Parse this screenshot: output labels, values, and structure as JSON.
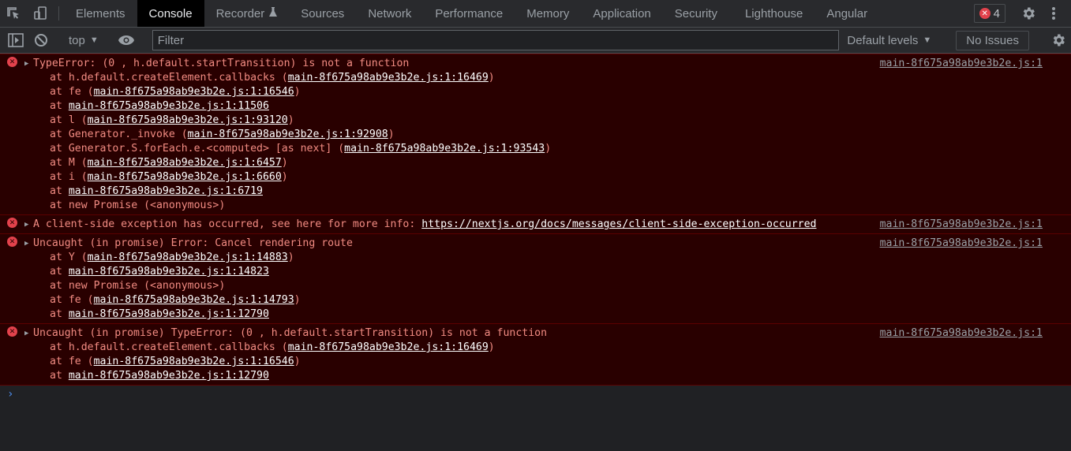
{
  "tabbar": {
    "tabs": [
      {
        "label": "Elements",
        "active": false
      },
      {
        "label": "Console",
        "active": true
      },
      {
        "label": "Recorder",
        "active": false
      },
      {
        "label": "Sources",
        "active": false
      },
      {
        "label": "Network",
        "active": false
      },
      {
        "label": "Performance",
        "active": false
      },
      {
        "label": "Memory",
        "active": false
      },
      {
        "label": "Application",
        "active": false
      },
      {
        "label": "Security",
        "active": false
      },
      {
        "label": "Lighthouse",
        "active": false
      },
      {
        "label": "Angular",
        "active": false
      }
    ],
    "error_count": "4"
  },
  "toolbar": {
    "context": "top",
    "filter_placeholder": "Filter",
    "filter_value": "",
    "levels": "Default levels",
    "issues": "No Issues"
  },
  "messages": [
    {
      "text": "TypeError: (0 , h.default.startTransition) is not a function",
      "source": "main-8f675a98ab9e3b2e.js:1",
      "frames": [
        {
          "prefix": "at h.default.createElement.callbacks (",
          "link": "main-8f675a98ab9e3b2e.js:1:16469",
          "suffix": ")"
        },
        {
          "prefix": "at fe (",
          "link": "main-8f675a98ab9e3b2e.js:1:16546",
          "suffix": ")"
        },
        {
          "prefix": "at ",
          "link": "main-8f675a98ab9e3b2e.js:1:11506",
          "suffix": ""
        },
        {
          "prefix": "at l (",
          "link": "main-8f675a98ab9e3b2e.js:1:93120",
          "suffix": ")"
        },
        {
          "prefix": "at Generator._invoke (",
          "link": "main-8f675a98ab9e3b2e.js:1:92908",
          "suffix": ")"
        },
        {
          "prefix": "at Generator.S.forEach.e.<computed> [as next] (",
          "link": "main-8f675a98ab9e3b2e.js:1:93543",
          "suffix": ")"
        },
        {
          "prefix": "at M (",
          "link": "main-8f675a98ab9e3b2e.js:1:6457",
          "suffix": ")"
        },
        {
          "prefix": "at i (",
          "link": "main-8f675a98ab9e3b2e.js:1:6660",
          "suffix": ")"
        },
        {
          "prefix": "at ",
          "link": "main-8f675a98ab9e3b2e.js:1:6719",
          "suffix": ""
        },
        {
          "prefix": "at new Promise (<anonymous>)",
          "link": "",
          "suffix": ""
        }
      ]
    },
    {
      "text": "A client-side exception has occurred, see here for more info: ",
      "text_link": "https://nextjs.org/docs/messages/client-side-exception-occurred",
      "source": "main-8f675a98ab9e3b2e.js:1",
      "frames": []
    },
    {
      "text": "Uncaught (in promise) Error: Cancel rendering route",
      "source": "main-8f675a98ab9e3b2e.js:1",
      "frames": [
        {
          "prefix": "at Y (",
          "link": "main-8f675a98ab9e3b2e.js:1:14883",
          "suffix": ")"
        },
        {
          "prefix": "at ",
          "link": "main-8f675a98ab9e3b2e.js:1:14823",
          "suffix": ""
        },
        {
          "prefix": "at new Promise (<anonymous>)",
          "link": "",
          "suffix": ""
        },
        {
          "prefix": "at fe (",
          "link": "main-8f675a98ab9e3b2e.js:1:14793",
          "suffix": ")"
        },
        {
          "prefix": "at ",
          "link": "main-8f675a98ab9e3b2e.js:1:12790",
          "suffix": ""
        }
      ]
    },
    {
      "text": "Uncaught (in promise) TypeError: (0 , h.default.startTransition) is not a function",
      "source": "main-8f675a98ab9e3b2e.js:1",
      "frames": [
        {
          "prefix": "at h.default.createElement.callbacks (",
          "link": "main-8f675a98ab9e3b2e.js:1:16469",
          "suffix": ")"
        },
        {
          "prefix": "at fe (",
          "link": "main-8f675a98ab9e3b2e.js:1:16546",
          "suffix": ")"
        },
        {
          "prefix": "at ",
          "link": "main-8f675a98ab9e3b2e.js:1:12790",
          "suffix": ""
        }
      ]
    }
  ],
  "colors": {
    "error_text": "#f28b82",
    "error_bg": "#290000",
    "error_icon": "#e2424c",
    "prompt": "#4d8ff0"
  }
}
